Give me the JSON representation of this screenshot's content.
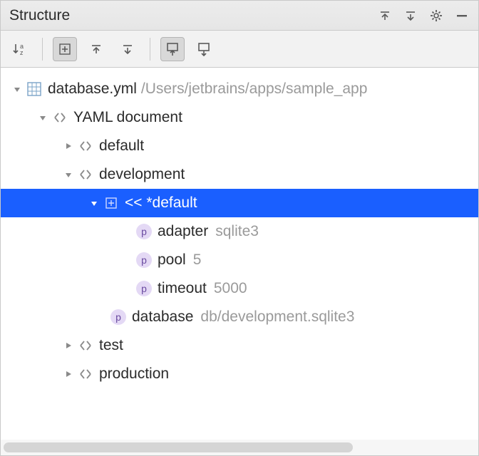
{
  "panel": {
    "title": "Structure"
  },
  "tree": {
    "file": {
      "name": "database.yml",
      "path": "/Users/jetbrains/apps/sample_app"
    },
    "doc_label": "YAML document",
    "default_label": "default",
    "development": {
      "label": "development",
      "merge": {
        "label": "<<  *default",
        "props": [
          {
            "name": "adapter",
            "value": "sqlite3"
          },
          {
            "name": "pool",
            "value": "5"
          },
          {
            "name": "timeout",
            "value": "5000"
          }
        ]
      },
      "database": {
        "name": "database",
        "value": "db/development.sqlite3"
      }
    },
    "test_label": "test",
    "production_label": "production"
  }
}
